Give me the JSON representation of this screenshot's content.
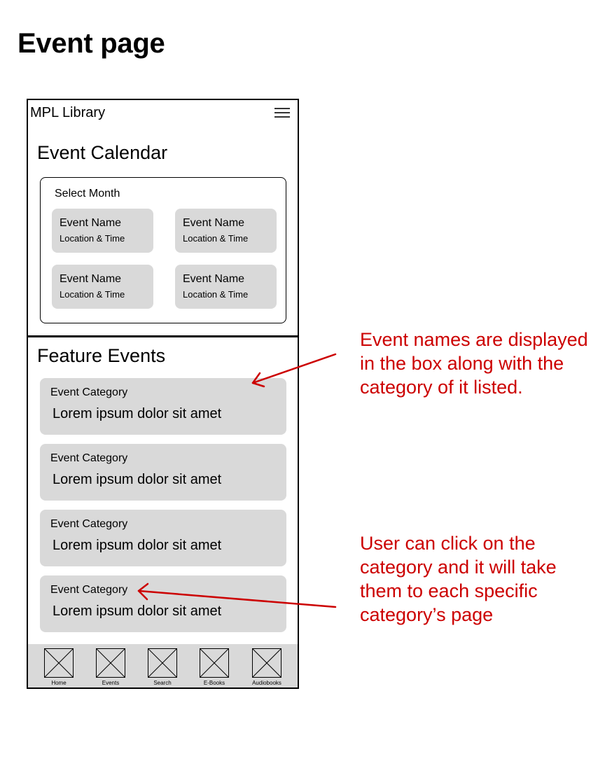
{
  "page": {
    "title": "Event page"
  },
  "app": {
    "name": "MPL Library"
  },
  "calendar": {
    "title": "Event Calendar",
    "select_month": "Select Month",
    "events": [
      {
        "name": "Event Name",
        "location_time": "Location & Time"
      },
      {
        "name": "Event Name",
        "location_time": "Location & Time"
      },
      {
        "name": "Event Name",
        "location_time": "Location & Time"
      },
      {
        "name": "Event Name",
        "location_time": "Location & Time"
      }
    ]
  },
  "features": {
    "title": "Feature Events",
    "items": [
      {
        "category": "Event Category",
        "text": "Lorem ipsum dolor sit amet"
      },
      {
        "category": "Event Category",
        "text": "Lorem ipsum dolor sit amet"
      },
      {
        "category": "Event Category",
        "text": "Lorem ipsum dolor sit amet"
      },
      {
        "category": "Event Category",
        "text": "Lorem ipsum dolor sit amet"
      }
    ]
  },
  "nav": {
    "items": [
      {
        "label": "Home",
        "icon": "image-placeholder-icon"
      },
      {
        "label": "Events",
        "icon": "image-placeholder-icon"
      },
      {
        "label": "Search",
        "icon": "image-placeholder-icon"
      },
      {
        "label": "E-Books",
        "icon": "image-placeholder-icon"
      },
      {
        "label": "Audiobooks",
        "icon": "image-placeholder-icon"
      }
    ]
  },
  "annotations": [
    {
      "text": "Event names are displayed in the box along with the category of it listed."
    },
    {
      "text": "User can click on the category and it will take them to each specific category’s page"
    }
  ],
  "colors": {
    "annotation": "#cc0000",
    "card_fill": "#d9d9d9"
  }
}
